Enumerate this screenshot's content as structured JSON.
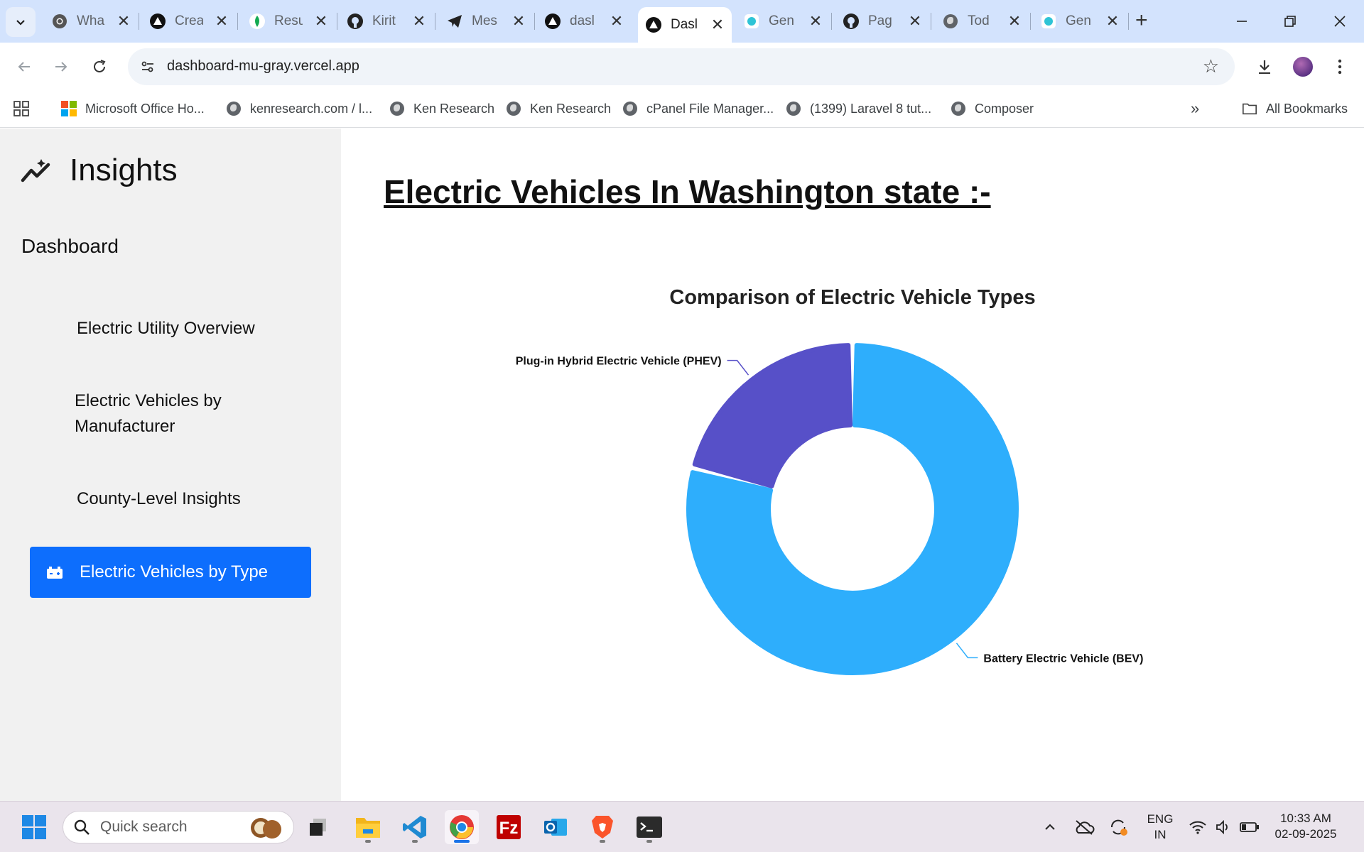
{
  "browser": {
    "tabs": [
      {
        "title": "Wha",
        "icon": "chrome-icon"
      },
      {
        "title": "Crea",
        "icon": "vercel-icon"
      },
      {
        "title": "Resu",
        "icon": "mongodb-icon"
      },
      {
        "title": "Kirit",
        "icon": "github-icon"
      },
      {
        "title": "Mes",
        "icon": "telegram-icon"
      },
      {
        "title": "dasl",
        "icon": "vercel-icon"
      },
      {
        "title": "Dasl",
        "icon": "vercel-icon",
        "active": true
      },
      {
        "title": "Gen",
        "icon": "gemini-icon"
      },
      {
        "title": "Pag",
        "icon": "github-icon"
      },
      {
        "title": "Tod",
        "icon": "globe-icon"
      },
      {
        "title": "Gen",
        "icon": "gemini-icon"
      }
    ],
    "url": "dashboard-mu-gray.vercel.app",
    "bookmarks": [
      {
        "label": "Microsoft Office Ho...",
        "icon": "microsoft-icon"
      },
      {
        "label": "kenresearch.com / l...",
        "icon": "globe-icon"
      },
      {
        "label": "Ken Research",
        "icon": "globe-icon"
      },
      {
        "label": "Ken Research",
        "icon": "globe-icon"
      },
      {
        "label": "cPanel File Manager...",
        "icon": "globe-icon"
      },
      {
        "label": "(1399) Laravel 8 tut...",
        "icon": "globe-icon"
      },
      {
        "label": "Composer",
        "icon": "globe-icon"
      }
    ],
    "all_bookmarks_label": "All Bookmarks"
  },
  "sidebar": {
    "brand": "Insights",
    "section": "Dashboard",
    "items": [
      {
        "label": "Electric Utility Overview"
      },
      {
        "label_line1": "Electric Vehicles by",
        "label_line2": "Manufacturer"
      },
      {
        "label": "County-Level Insights"
      },
      {
        "label": "Electric Vehicles by Type",
        "active": true
      }
    ]
  },
  "main": {
    "title": "Electric Vehicles In Washington state :-"
  },
  "chart_data": {
    "type": "pie",
    "variant": "donut",
    "title": "Comparison of Electric Vehicle Types",
    "categories": [
      "Battery Electric Vehicle (BEV)",
      "Plug-in Hybrid Electric Vehicle (PHEV)"
    ],
    "values": [
      79,
      21
    ],
    "colors": [
      "#2eaefc",
      "#5750c8"
    ],
    "legend": "none"
  },
  "taskbar": {
    "search_placeholder": "Quick search",
    "apps": [
      "file-explorer-icon",
      "vscode-icon",
      "chrome-icon",
      "filezilla-icon",
      "outlook-icon",
      "brave-icon",
      "terminal-icon"
    ],
    "lang_line1": "ENG",
    "lang_line2": "IN",
    "time": "10:33 AM",
    "date": "02-09-2025"
  }
}
